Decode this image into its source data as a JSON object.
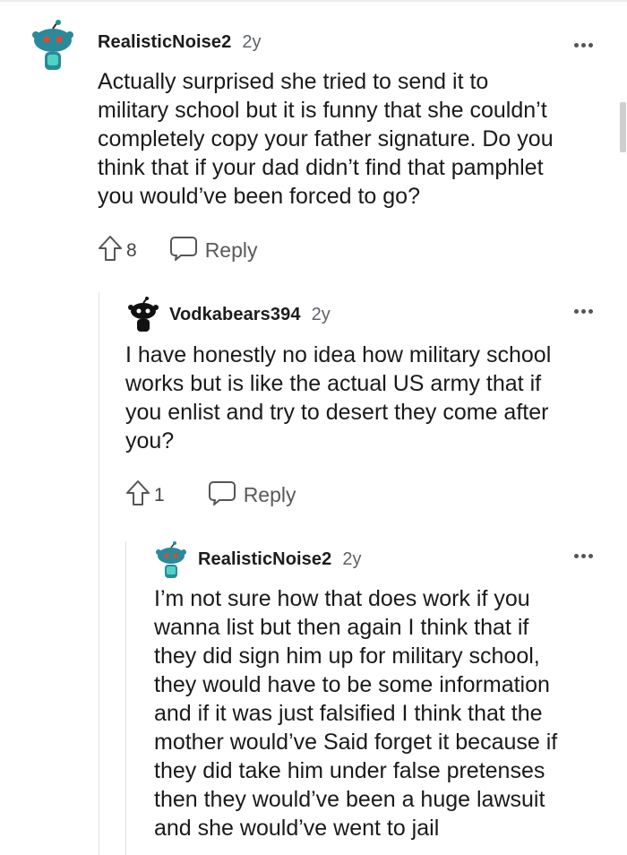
{
  "comments": [
    {
      "username": "RealisticNoise2",
      "age": "2y",
      "lines": [
        "Actually surprised she tried to send it to",
        "military school but it is funny that she couldn’t",
        "completely copy your father signature. Do you",
        "think that if your dad didn’t find that pamphlet",
        "you would’ve been forced to go?"
      ],
      "votes": "8",
      "reply_label": "Reply",
      "avatar_color": "#2a8a9a"
    },
    {
      "username": "Vodkabears394",
      "age": "2y",
      "lines": [
        "I have honestly no idea how military school",
        "works but is like the actual US army that if",
        "you enlist and try to desert they come after",
        "you?"
      ],
      "votes": "1",
      "reply_label": "Reply",
      "avatar_color": "#111111"
    },
    {
      "username": "RealisticNoise2",
      "age": "2y",
      "lines": [
        "I’m not sure how that does work if you",
        "wanna list but then again I think that if",
        "they did sign him up for military school,",
        "they would have to be some information",
        "and if it was just falsified I think that the",
        "mother would’ve Said forget it because if",
        "they did take him under false pretenses",
        "then they would’ve been a huge lawsuit",
        "and she would’ve went to jail"
      ],
      "avatar_color": "#2a8a9a"
    }
  ]
}
